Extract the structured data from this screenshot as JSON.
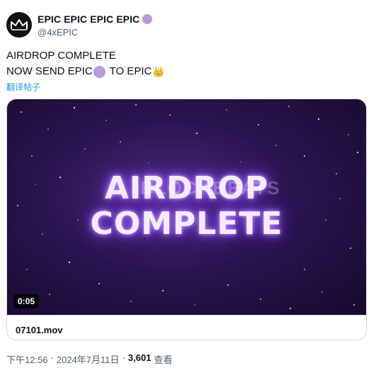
{
  "author": {
    "display_name": "EPIC EPIC EPIC EPIC",
    "handle": "@4xEPIC",
    "more_label": "···",
    "avatar_icon": "crown-icon",
    "badge_color": "#b69ad9"
  },
  "tweet": {
    "line1": "AIRDROP COMPLETE",
    "line2_a": "NOW SEND EPIC",
    "line2_b": " TO EPIC",
    "emoji_crown": "👑",
    "translate_label": "翻译帖子"
  },
  "media": {
    "title_line1": "AIRDROP",
    "title_line2": "COMPLETE",
    "watermark": "BLOCKBEATS",
    "duration": "0:05",
    "file_name": "07101.mov"
  },
  "footer": {
    "time": "下午12:56",
    "separator": "·",
    "date": "2024年7月11日",
    "views_count": "3,601",
    "views_label": "查看"
  }
}
